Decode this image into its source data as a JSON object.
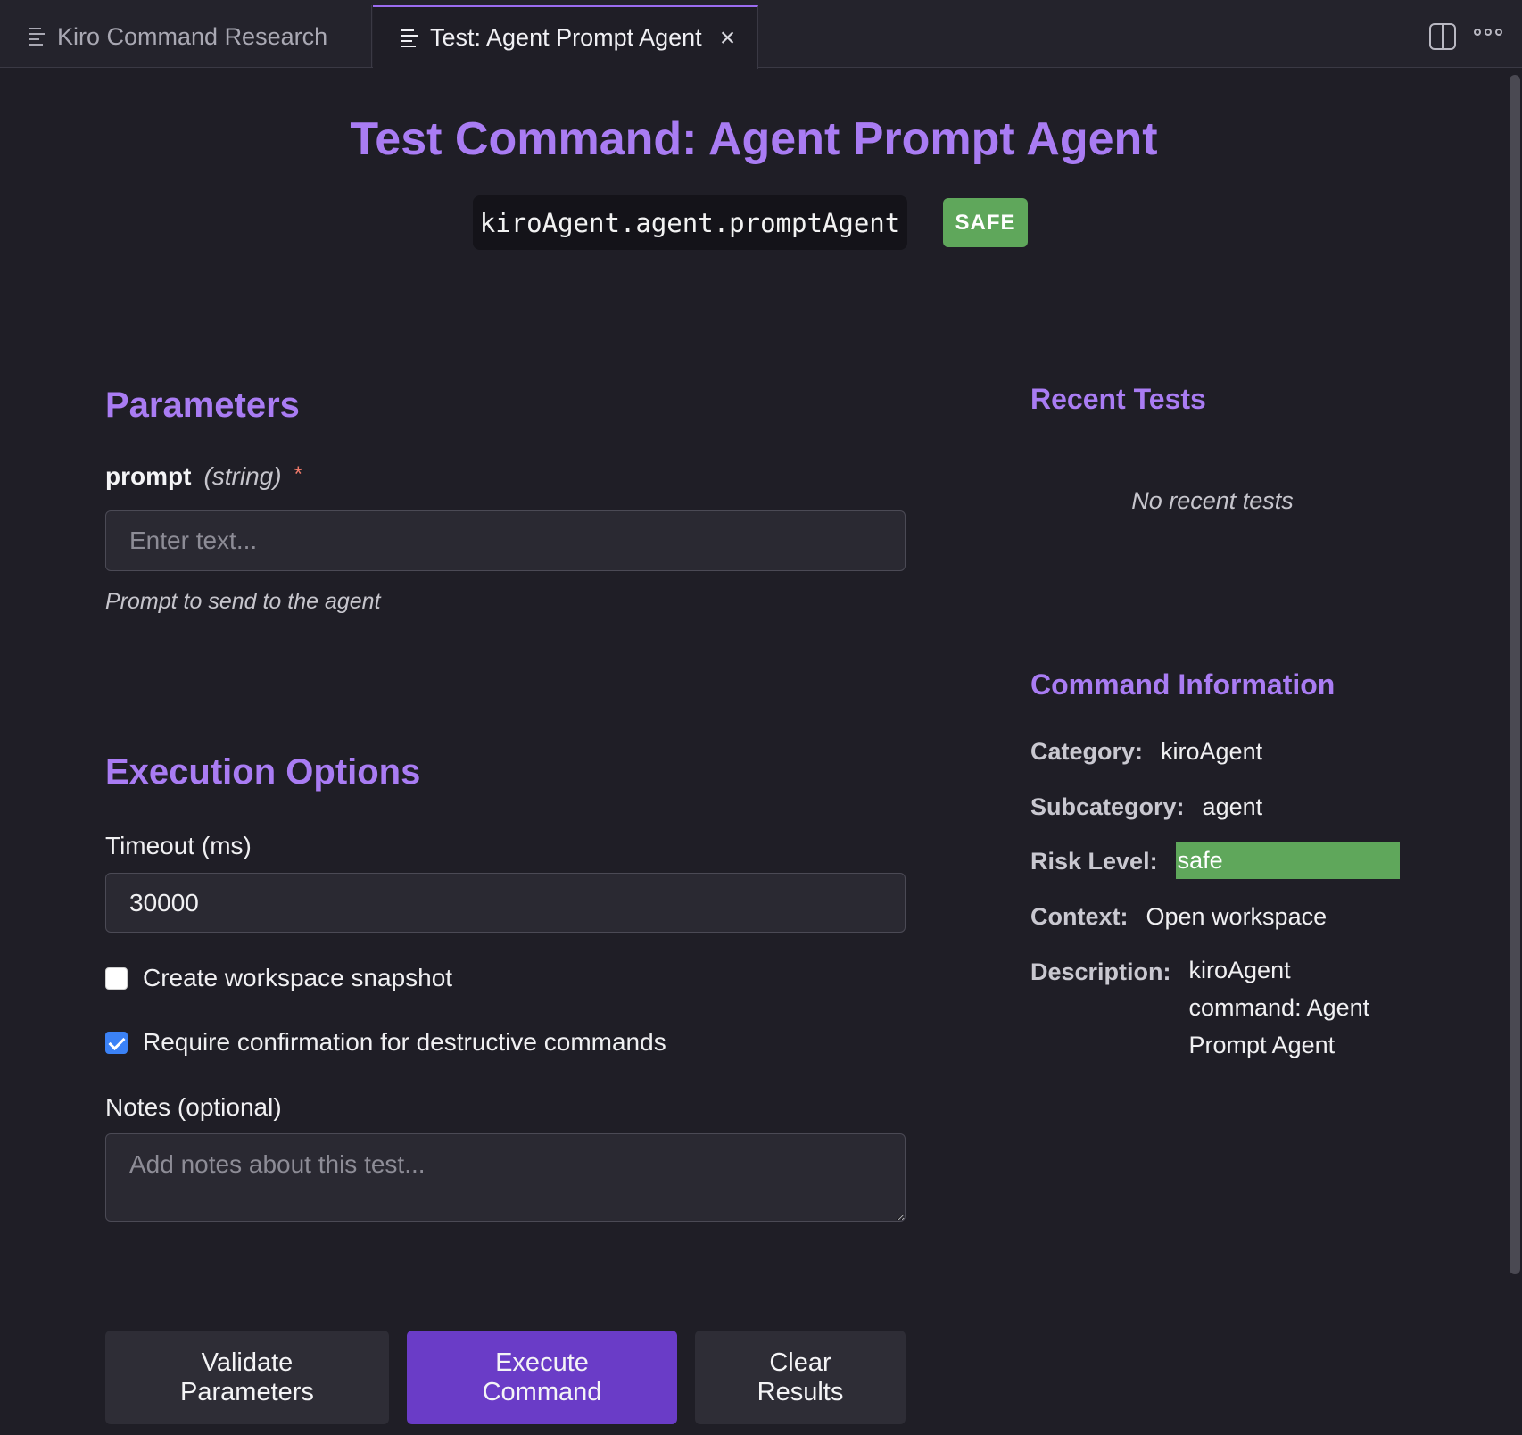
{
  "tabs": [
    {
      "label": "Kiro Command Research"
    },
    {
      "label": "Test: Agent Prompt Agent"
    }
  ],
  "header": {
    "title": "Test Command: Agent Prompt Agent",
    "command_id": "kiroAgent.agent.promptAgent",
    "badge": "SAFE"
  },
  "parameters": {
    "heading": "Parameters",
    "items": [
      {
        "name": "prompt",
        "type": "(string)",
        "required_marker": "*",
        "placeholder": "Enter text...",
        "value": "",
        "hint": "Prompt to send to the agent"
      }
    ]
  },
  "execution": {
    "heading": "Execution Options",
    "timeout_label": "Timeout (ms)",
    "timeout_value": "30000",
    "snapshot_label": "Create workspace snapshot",
    "snapshot_checked": false,
    "confirm_label": "Require confirmation for destructive commands",
    "confirm_checked": true,
    "notes_label": "Notes (optional)",
    "notes_placeholder": "Add notes about this test..."
  },
  "buttons": {
    "validate_line1": "Validate",
    "validate_line2": "Parameters",
    "execute_line1": "Execute",
    "execute_line2": "Command",
    "clear_line1": "Clear",
    "clear_line2": "Results"
  },
  "recent_tests": {
    "heading": "Recent Tests",
    "empty_text": "No recent tests"
  },
  "command_info": {
    "heading": "Command Information",
    "category_label": "Category:",
    "category": "kiroAgent",
    "subcategory_label": "Subcategory:",
    "subcategory": "agent",
    "risk_label": "Risk Level:",
    "risk": "safe",
    "context_label": "Context:",
    "context": "Open workspace",
    "description_label": "Description:",
    "description": "kiroAgent command: Agent Prompt Agent"
  },
  "icons": {
    "tab_icon": "list-lines-icon",
    "close": "close-icon",
    "split_editor": "split-editor-icon",
    "more": "more-actions-icon"
  },
  "colors": {
    "accent": "#a97cf3",
    "primary_button": "#6a3cc7",
    "safe": "#5fa75b",
    "checkbox_checked": "#3b82f6",
    "background": "#1f1e26"
  }
}
